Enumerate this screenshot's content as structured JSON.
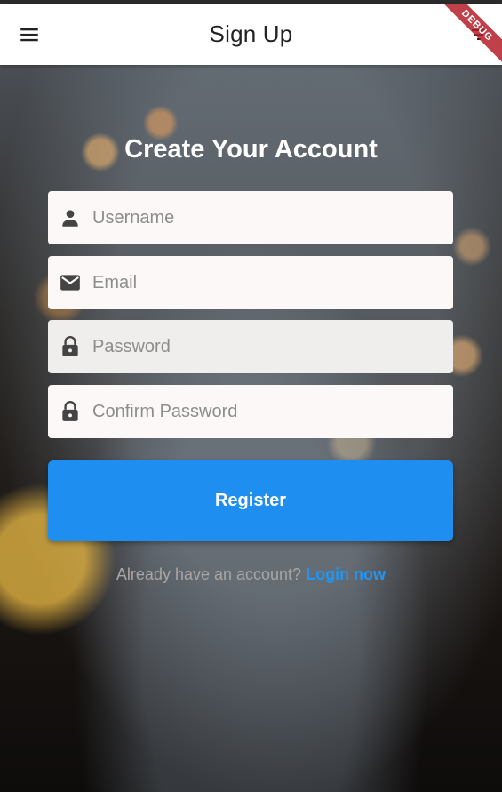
{
  "appbar": {
    "title": "Sign Up",
    "menu_icon": "menu-icon",
    "action_icon": "filter-icon",
    "debug_label": "DEBUG"
  },
  "form": {
    "heading": "Create Your Account",
    "username_placeholder": "Username",
    "email_placeholder": "Email",
    "password_placeholder": "Password",
    "confirm_password_placeholder": "Confirm Password",
    "register_label": "Register"
  },
  "footer": {
    "prompt": "Already have an account? ",
    "login_label": "Login now"
  },
  "colors": {
    "accent": "#1e8ff0",
    "link": "#2196f3",
    "field_bg": "#fbf8f7",
    "debug_ribbon": "#b41e28"
  }
}
